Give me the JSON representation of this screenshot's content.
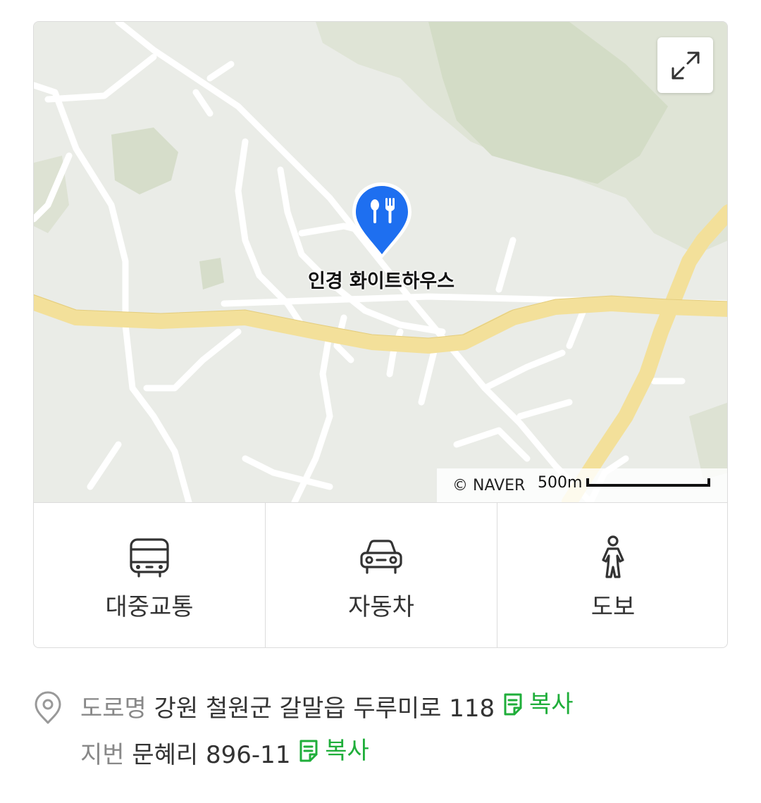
{
  "map": {
    "place_name": "인경 화이트하우스",
    "copyright": "© NAVER",
    "scale_label": "500m",
    "pin_color": "#1e6ff0",
    "expand_icon": "expand-icon"
  },
  "directions": [
    {
      "label": "대중교통",
      "icon": "bus-icon"
    },
    {
      "label": "자동차",
      "icon": "car-icon"
    },
    {
      "label": "도보",
      "icon": "walk-icon"
    }
  ],
  "address": {
    "road_key": "도로명",
    "road_value": "강원 철원군 갈말읍 두루미로 118",
    "lot_key": "지번",
    "lot_value": "문혜리 896-11",
    "copy_label": "복사",
    "copy_color": "#1fae3a"
  }
}
